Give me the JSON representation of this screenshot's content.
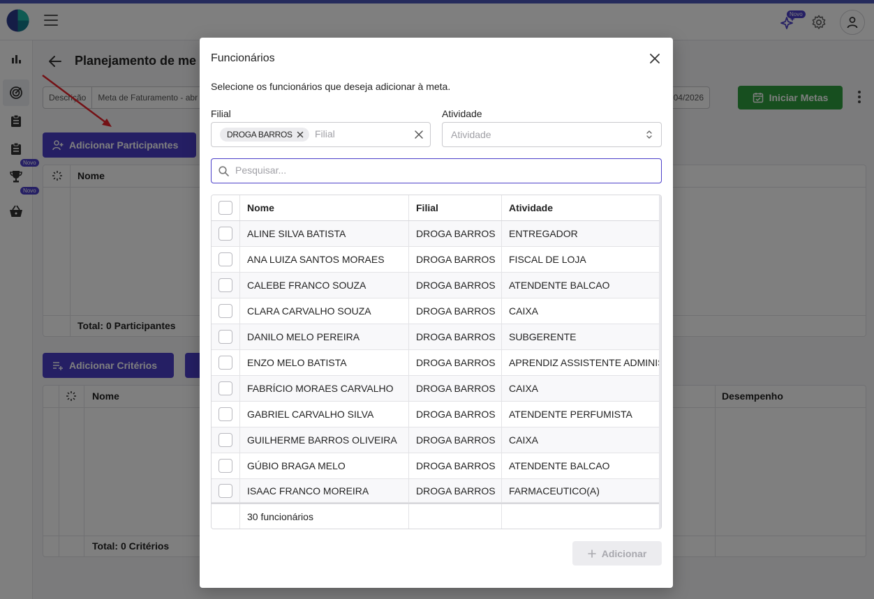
{
  "header": {
    "ai_badge": "Novo"
  },
  "sidebar": {
    "badges": [
      "Novo",
      "Novo"
    ]
  },
  "page": {
    "title": "Planejamento de me",
    "description_label": "Descrição",
    "description_value": "Meta de Faturamento - abr",
    "date_value": "04/2026",
    "start_button": "Iniciar Metas",
    "add_participants_button": "Adicionar Participantes",
    "add_criteria_button": "Adicionar Critérios",
    "participants_table": {
      "col_nome": "Nome",
      "footer": "Total: 0 Participantes"
    },
    "criteria_table": {
      "col_nome": "Nome",
      "col_desempenho": "Desempenho",
      "footer": "Total: 0 Critérios"
    }
  },
  "modal": {
    "title": "Funcionários",
    "subtitle": "Selecione os funcionários que deseja adicionar à meta.",
    "filial_label": "Filial",
    "filial_chip": "DROGA BARROS",
    "filial_placeholder": "Filial",
    "atividade_label": "Atividade",
    "atividade_placeholder": "Atividade",
    "search_placeholder": "Pesquisar...",
    "columns": {
      "nome": "Nome",
      "filial": "Filial",
      "atividade": "Atividade"
    },
    "rows": [
      {
        "nome": "ALINE SILVA BATISTA",
        "filial": "DROGA BARROS",
        "atividade": "ENTREGADOR"
      },
      {
        "nome": "ANA LUIZA SANTOS MORAES",
        "filial": "DROGA BARROS",
        "atividade": "FISCAL DE LOJA"
      },
      {
        "nome": "CALEBE FRANCO SOUZA",
        "filial": "DROGA BARROS",
        "atividade": "ATENDENTE BALCAO"
      },
      {
        "nome": "CLARA CARVALHO SOUZA",
        "filial": "DROGA BARROS",
        "atividade": "CAIXA"
      },
      {
        "nome": "DANILO MELO PEREIRA",
        "filial": "DROGA BARROS",
        "atividade": "SUBGERENTE"
      },
      {
        "nome": "ENZO MELO BATISTA",
        "filial": "DROGA BARROS",
        "atividade": "APRENDIZ ASSISTENTE ADMINIST"
      },
      {
        "nome": "FABRÍCIO MORAES CARVALHO",
        "filial": "DROGA BARROS",
        "atividade": "CAIXA"
      },
      {
        "nome": "GABRIEL CARVALHO SILVA",
        "filial": "DROGA BARROS",
        "atividade": "ATENDENTE PERFUMISTA"
      },
      {
        "nome": "GUILHERME BARROS OLIVEIRA",
        "filial": "DROGA BARROS",
        "atividade": "CAIXA"
      },
      {
        "nome": "GÚBIO BRAGA MELO",
        "filial": "DROGA BARROS",
        "atividade": "ATENDENTE BALCAO"
      },
      {
        "nome": "ISAAC FRANCO MOREIRA",
        "filial": "DROGA BARROS",
        "atividade": "FARMACEUTICO(A)"
      }
    ],
    "footer_count": "30 funcionários",
    "add_button": "Adicionar"
  },
  "colors": {
    "primary": "#4b3fc9",
    "success": "#2e9e3e",
    "annotation_arrow": "#e8222a"
  }
}
